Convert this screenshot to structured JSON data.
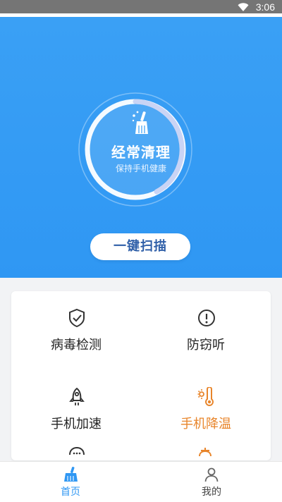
{
  "status_bar": {
    "time": "3:06"
  },
  "hero": {
    "title": "经常清理",
    "subtitle": "保持手机健康",
    "scan_button": "一键扫描"
  },
  "tools": [
    {
      "label": "病毒检测",
      "icon": "shield-check-icon"
    },
    {
      "label": "防窃听",
      "icon": "alert-circle-icon"
    },
    {
      "label": "手机加速",
      "icon": "rocket-icon"
    },
    {
      "label": "手机降温",
      "icon": "thermometer-icon"
    }
  ],
  "tab_bar": {
    "tabs": [
      {
        "label": "首页",
        "icon": "broom-icon",
        "active": true
      },
      {
        "label": "我的",
        "icon": "user-icon",
        "active": false
      }
    ]
  },
  "colors": {
    "primary": "#2f97f3",
    "accent_orange": "#e8852b"
  }
}
